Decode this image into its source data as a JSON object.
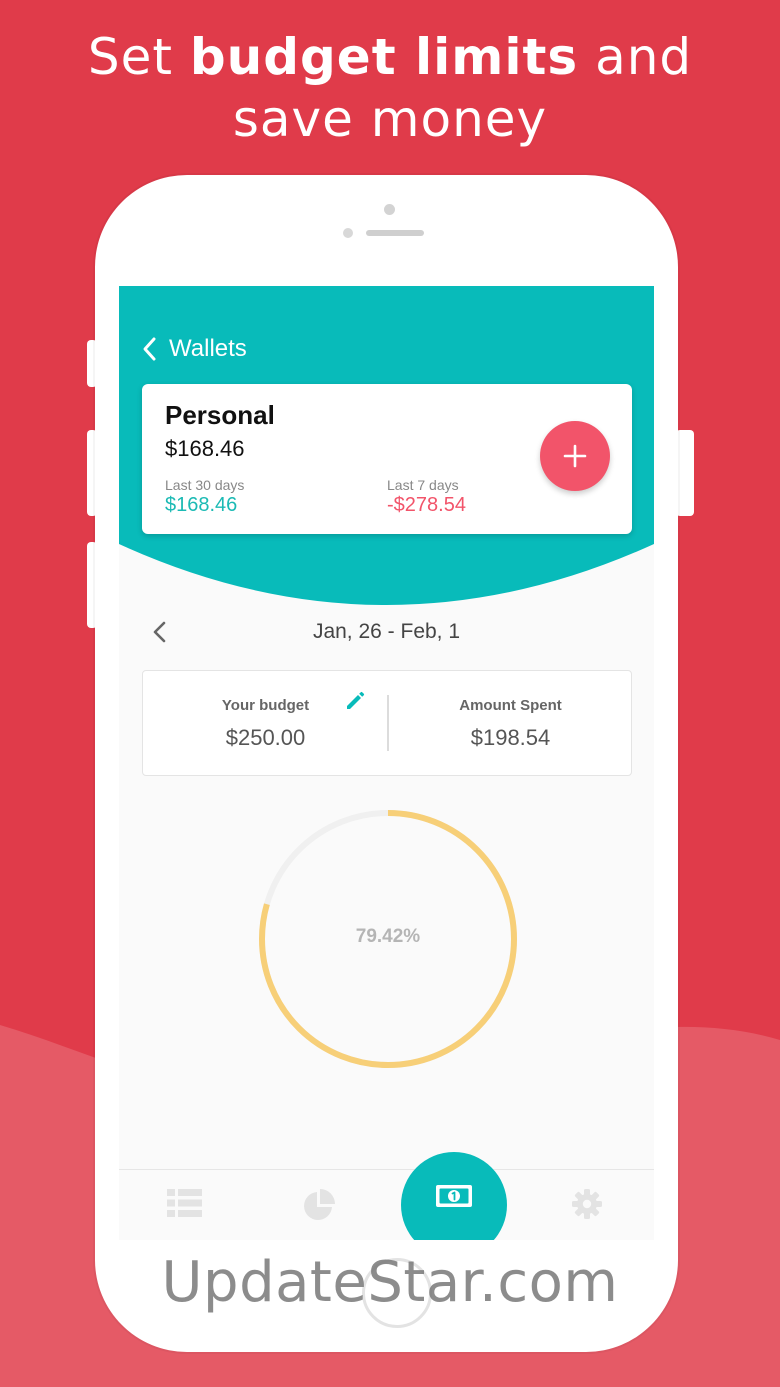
{
  "headline": {
    "line1_pre": "Set ",
    "line1_bold": "budget limits",
    "line1_post": " and",
    "line2": "save money"
  },
  "colors": {
    "background": "#E03B4A",
    "teal": "#08BBBA",
    "accent_pink": "#F2546A",
    "positive": "#1BBAB4",
    "negative": "#F2546A",
    "ring": "#F7CF78"
  },
  "nav": {
    "back_label": "Wallets",
    "back_icon": "chevron-left-icon"
  },
  "wallet": {
    "name": "Personal",
    "balance": "$168.46",
    "last30_label": "Last 30 days",
    "last30_value": "$168.46",
    "last7_label": "Last 7 days",
    "last7_value": "-$278.54",
    "add_icon": "plus-icon"
  },
  "period": {
    "range": "Jan, 26 - Feb, 1",
    "prev_icon": "chevron-left-icon"
  },
  "budget": {
    "budget_label": "Your budget",
    "budget_value": "$250.00",
    "spent_label": "Amount Spent",
    "spent_value": "$198.54",
    "edit_icon": "pencil-icon"
  },
  "progress": {
    "percent_text": "79.42%",
    "fraction": 0.7942
  },
  "tabs": [
    {
      "icon": "list-icon",
      "active": false
    },
    {
      "icon": "pie-chart-icon",
      "active": false
    },
    {
      "icon": "banknote-icon",
      "active": true
    },
    {
      "icon": "gear-icon",
      "active": false
    }
  ],
  "watermark": "UpdateStar.com"
}
